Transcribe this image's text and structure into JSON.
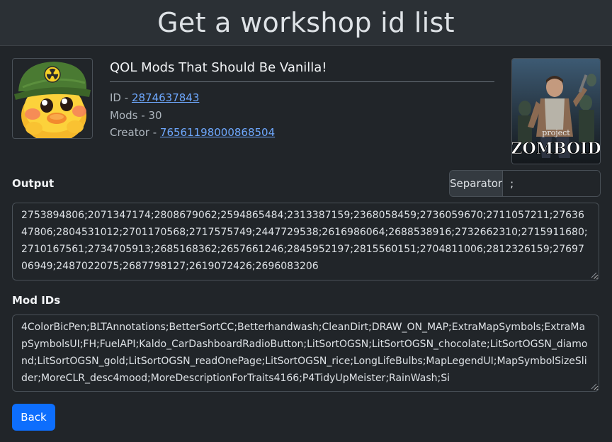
{
  "header": {
    "title": "Get a workshop id list"
  },
  "collection": {
    "title": "QOL Mods That Should Be Vanilla!",
    "id_label": "ID - ",
    "id_value": "2874637843",
    "mods_text": "Mods - 30",
    "creator_label": "Creator - ",
    "creator_value": "76561198000868504",
    "cover_text_top": "project",
    "cover_text_main": "ZOMBOID"
  },
  "output": {
    "label": "Output",
    "separator_label": "Separator",
    "separator_value": ";",
    "value": "2753894806;2071347174;2808679062;2594865484;2313387159;2368058459;2736059670;2711057211;2763647806;2804531012;2701170568;2717575749;2447729538;2616986064;2688538916;2732662310;2715911680;2710167561;2734705913;2685168362;2657661246;2845952197;2815560151;2704811006;2812326159;2769706949;2487022075;2687798127;2619072426;2696083206"
  },
  "mod_ids": {
    "label": "Mod IDs",
    "value": "4ColorBicPen;BLTAnnotations;BetterSortCC;Betterhandwash;CleanDirt;DRAW_ON_MAP;ExtraMapSymbols;ExtraMapSymbolsUI;FH;FuelAPI;Kaldo_CarDashboardRadioButton;LitSortOGSN;LitSortOGSN_chocolate;LitSortOGSN_diamond;LitSortOGSN_gold;LitSortOGSN_readOnePage;LitSortOGSN_rice;LongLifeBulbs;MapLegendUI;MapSymbolSizeSlider;MoreCLR_desc4mood;MoreDescriptionForTraits4166;P4TidyUpMeister;RainWash;Si"
  },
  "footer": {
    "back_label": "Back"
  }
}
